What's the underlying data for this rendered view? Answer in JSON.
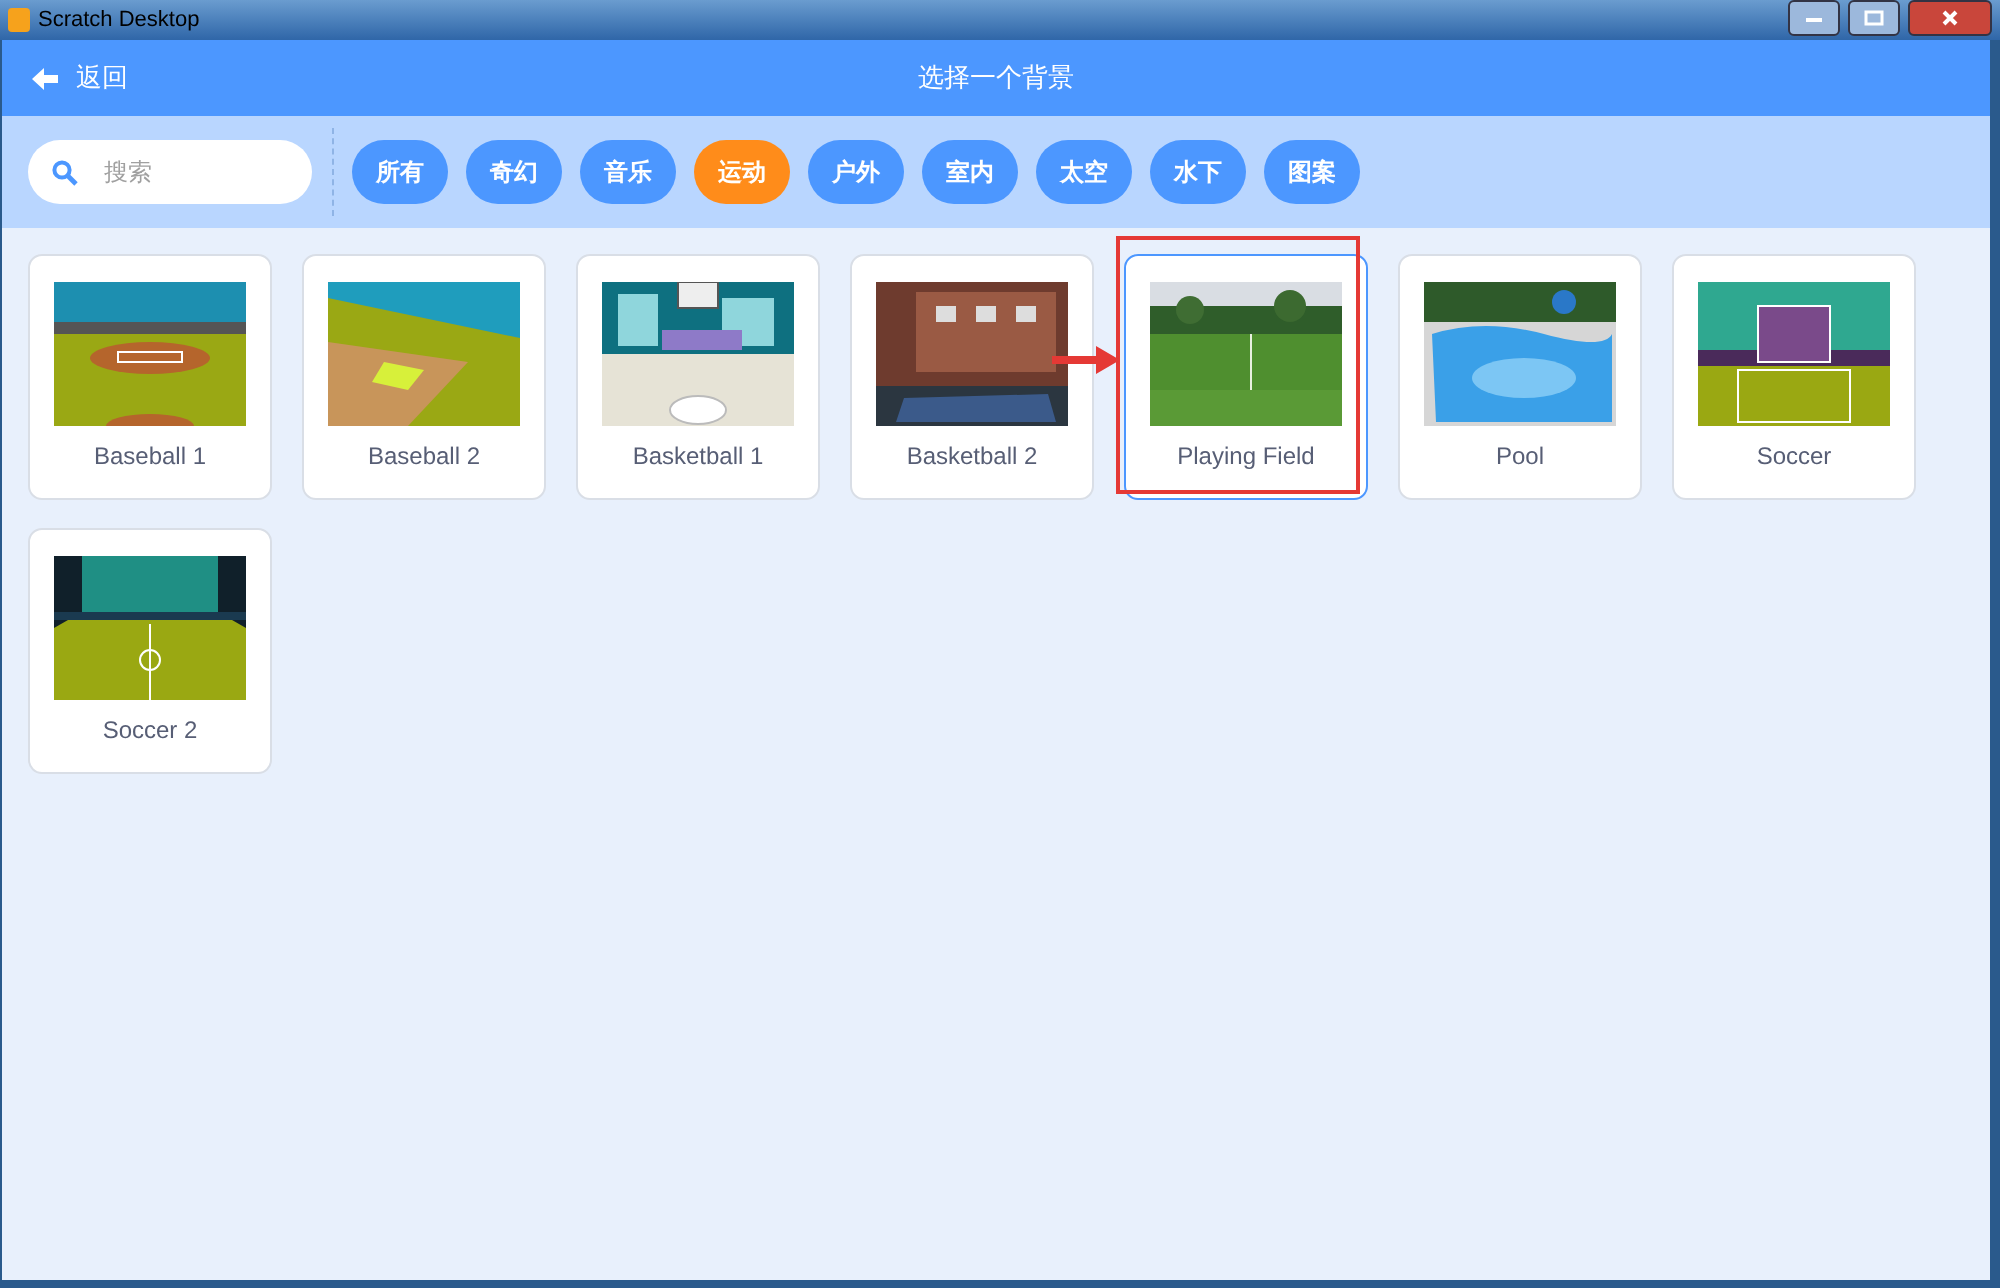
{
  "window": {
    "title": "Scratch Desktop"
  },
  "header": {
    "back": "返回",
    "title": "选择一个背景"
  },
  "search": {
    "placeholder": "搜索"
  },
  "tags": [
    {
      "label": "所有",
      "selected": false
    },
    {
      "label": "奇幻",
      "selected": false
    },
    {
      "label": "音乐",
      "selected": false
    },
    {
      "label": "运动",
      "selected": true
    },
    {
      "label": "户外",
      "selected": false
    },
    {
      "label": "室内",
      "selected": false
    },
    {
      "label": "太空",
      "selected": false
    },
    {
      "label": "水下",
      "selected": false
    },
    {
      "label": "图案",
      "selected": false
    }
  ],
  "backdrops": [
    {
      "name": "Baseball 1",
      "selected": false,
      "highlighted": false
    },
    {
      "name": "Baseball 2",
      "selected": false,
      "highlighted": false
    },
    {
      "name": "Basketball 1",
      "selected": false,
      "highlighted": false
    },
    {
      "name": "Basketball 2",
      "selected": false,
      "highlighted": false
    },
    {
      "name": "Playing Field",
      "selected": true,
      "highlighted": true
    },
    {
      "name": "Pool",
      "selected": false,
      "highlighted": false
    },
    {
      "name": "Soccer",
      "selected": false,
      "highlighted": false
    },
    {
      "name": "Soccer 2",
      "selected": false,
      "highlighted": false
    }
  ]
}
